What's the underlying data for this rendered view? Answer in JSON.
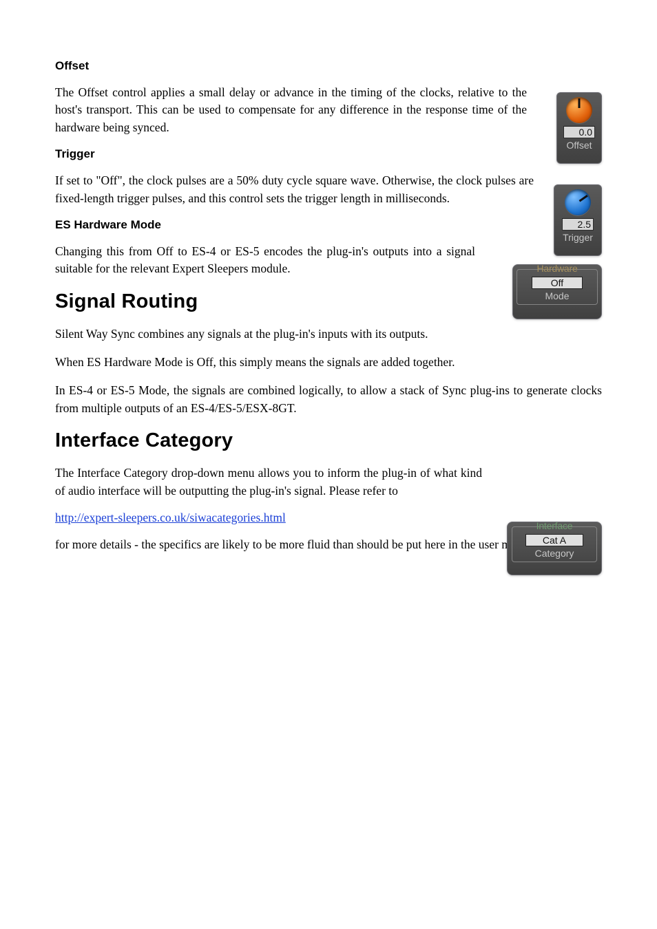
{
  "sections": {
    "offset": {
      "heading": "Offset",
      "body": "The Offset control applies a small delay or advance in the timing of the clocks, relative to the host's transport. This can be used to compensate for any difference in the response time of the hardware being synced."
    },
    "trigger": {
      "heading": "Trigger",
      "body": "If set to \"Off\", the clock pulses are a 50% duty cycle square wave. Otherwise, the clock pulses are fixed-length trigger pulses, and this control sets the trigger length in milliseconds."
    },
    "es_hw": {
      "heading": "ES Hardware Mode",
      "body": "Changing this from Off to ES-4 or ES-5 encodes the plug-in's outputs into a signal suitable for the relevant Expert Sleepers module."
    },
    "signal_routing": {
      "heading": "Signal Routing",
      "p1": "Silent Way Sync combines any signals at the plug-in's inputs with its outputs.",
      "p2": "When ES Hardware Mode is Off, this simply means the signals are added together.",
      "p3": "In ES-4 or ES-5 Mode, the signals are combined logically, to allow a stack of Sync plug-ins to generate clocks from multiple outputs of an ES-4/ES-5/ESX-8GT."
    },
    "interface_category": {
      "heading": "Interface Category",
      "p1": "The Interface Category drop-down menu allows you to inform the plug-in of what kind of audio interface will be outputting the plug-in's signal. Please refer to",
      "link_text": "http://expert-sleepers.co.uk/siwacategories.html",
      "link_href": "http://expert-sleepers.co.uk/siwacategories.html",
      "p2": "for more details - the specifics are likely to be more fluid than should be put here in the user manual."
    }
  },
  "widgets": {
    "offset": {
      "value": "0.0",
      "label": "Offset"
    },
    "trigger": {
      "value": "2.5",
      "label": "Trigger"
    },
    "hardware": {
      "legend": "Hardware",
      "value": "Off",
      "label": "Mode"
    },
    "interface": {
      "legend": "Interface",
      "value": "Cat A",
      "label": "Category"
    }
  }
}
